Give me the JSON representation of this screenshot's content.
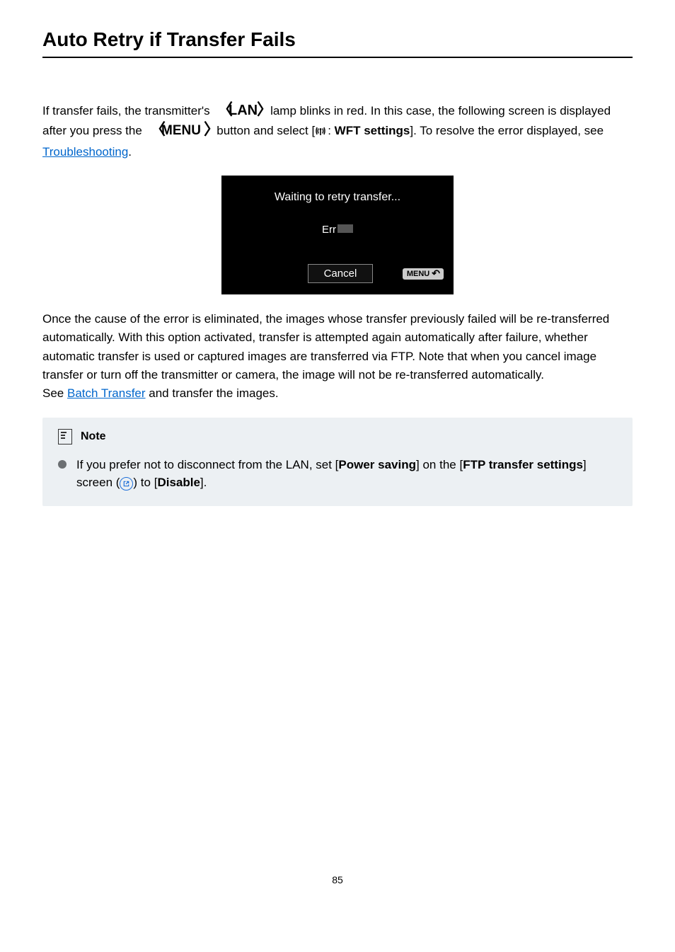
{
  "title": "Auto Retry if Transfer Fails",
  "para1_a": "If transfer fails, the transmitter's ",
  "para1_b": " lamp blinks in red. In this case, the following screen is displayed after you press the ",
  "para1_c": " button and select [",
  "para1_d": ": ",
  "para1_setting": "WFT settings",
  "para1_e": "]. To resolve the error displayed, see ",
  "para1_link": "Troubleshooting",
  "para1_f": ".",
  "icon_lan": "LAN",
  "icon_menu": "MENU",
  "screen": {
    "line1": "Waiting to retry transfer...",
    "err": "Err",
    "cancel": "Cancel",
    "menu": "MENU"
  },
  "para2_a": "Once the cause of the error is eliminated, the images whose transfer previously failed will be re-transferred automatically. With this option activated, transfer is attempted again automatically after failure, whether automatic transfer is used or captured images are transferred via FTP. Note that when you cancel image transfer or turn off the transmitter or camera, the image will not be re-transferred automatically.",
  "para2_b": "See ",
  "para2_link": "Batch Transfer",
  "para2_c": " and transfer the images.",
  "note": {
    "heading": "Note",
    "text_a": "If you prefer not to disconnect from the LAN, set [",
    "bold1": "Power saving",
    "text_b": "] on the [",
    "bold2": "FTP transfer settings",
    "text_c": "] screen (",
    "text_d": ") to [",
    "bold3": "Disable",
    "text_e": "]."
  },
  "page_number": "85"
}
